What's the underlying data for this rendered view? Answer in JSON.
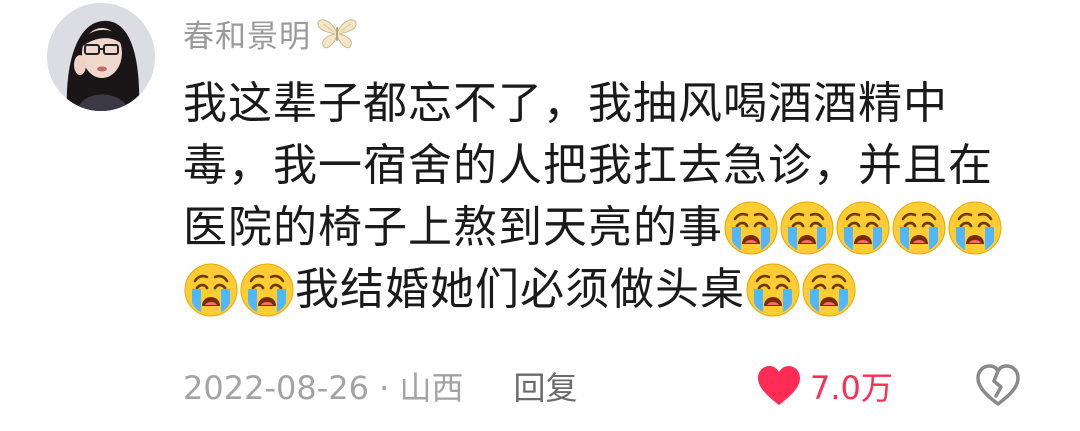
{
  "comment": {
    "username": "春和景明",
    "username_badge_icon": "butterfly-icon",
    "avatar_icon": "user-avatar",
    "text_lines": [
      "我这辈子都忘不了，我抽风喝酒酒精中",
      "毒，我一宿舍的人把我扛去急诊，并且在",
      "医院的椅子上熬到天亮的事",
      "我结婚她们必须做头桌"
    ],
    "emoji_name": "loudly-crying-face",
    "date": "2022-08-26",
    "separator": " · ",
    "location": "山西",
    "reply_label": "回复",
    "like_count": "7.0万",
    "colors": {
      "like": "#ff2d55",
      "meta": "#a3a3a3",
      "text": "#1a1a1a",
      "username": "#9a9a9a"
    }
  }
}
